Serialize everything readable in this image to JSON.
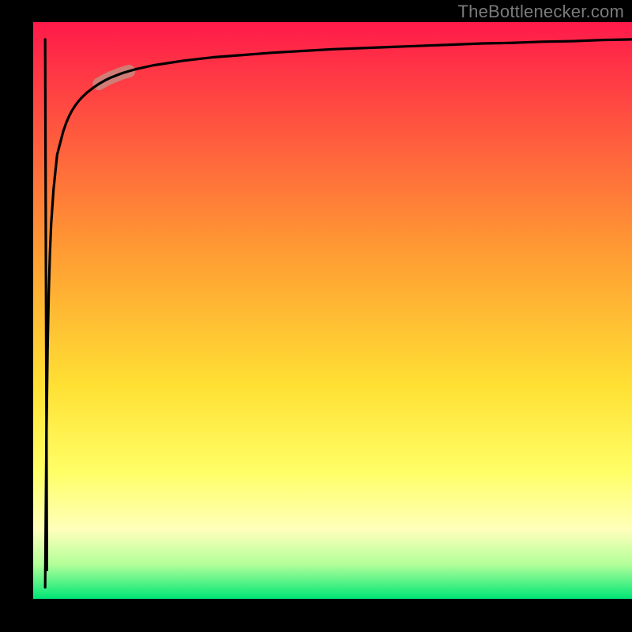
{
  "watermark": "TheBottlenecker.com",
  "chart_data": {
    "type": "line",
    "title": "",
    "xlabel": "",
    "ylabel": "",
    "xlim": [
      0,
      100
    ],
    "ylim": [
      0,
      100
    ],
    "background_gradient": {
      "stops": [
        {
          "offset": 0,
          "color": "#ff1a4a"
        },
        {
          "offset": 39,
          "color": "#ff9933"
        },
        {
          "offset": 63,
          "color": "#ffe033"
        },
        {
          "offset": 78,
          "color": "#ffff66"
        },
        {
          "offset": 88,
          "color": "#ffffbb"
        },
        {
          "offset": 94,
          "color": "#b3ff99"
        },
        {
          "offset": 100,
          "color": "#00e676"
        }
      ]
    },
    "curve": {
      "x": [
        2,
        2.2,
        2.4,
        2.6,
        2.8,
        3.0,
        3.2,
        3.4,
        3.6,
        3.8,
        4.0,
        4.5,
        5.0,
        5.5,
        6.0,
        6.5,
        7.0,
        7.5,
        8.0,
        9.0,
        10,
        11,
        12,
        13,
        14,
        15,
        17,
        20,
        25,
        30,
        35,
        40,
        45,
        50,
        55,
        60,
        65,
        70,
        75,
        80,
        85,
        90,
        95,
        100
      ],
      "y": [
        2,
        27,
        43,
        53,
        60,
        65,
        68,
        71,
        73,
        75,
        77,
        79,
        81,
        82.5,
        83.7,
        84.7,
        85.5,
        86.2,
        86.8,
        87.8,
        88.6,
        89.3,
        89.9,
        90.4,
        90.8,
        91.2,
        91.8,
        92.5,
        93.3,
        93.9,
        94.3,
        94.7,
        95.0,
        95.3,
        95.5,
        95.7,
        95.9,
        96.1,
        96.3,
        96.4,
        96.6,
        96.7,
        96.9,
        97.0
      ]
    },
    "highlight_segment": {
      "x_start": 11,
      "x_end": 16,
      "color": "#c88a80",
      "width": 16
    },
    "notes": "Axes have no tick labels; values are estimated percentages 0–100 on both axes."
  }
}
